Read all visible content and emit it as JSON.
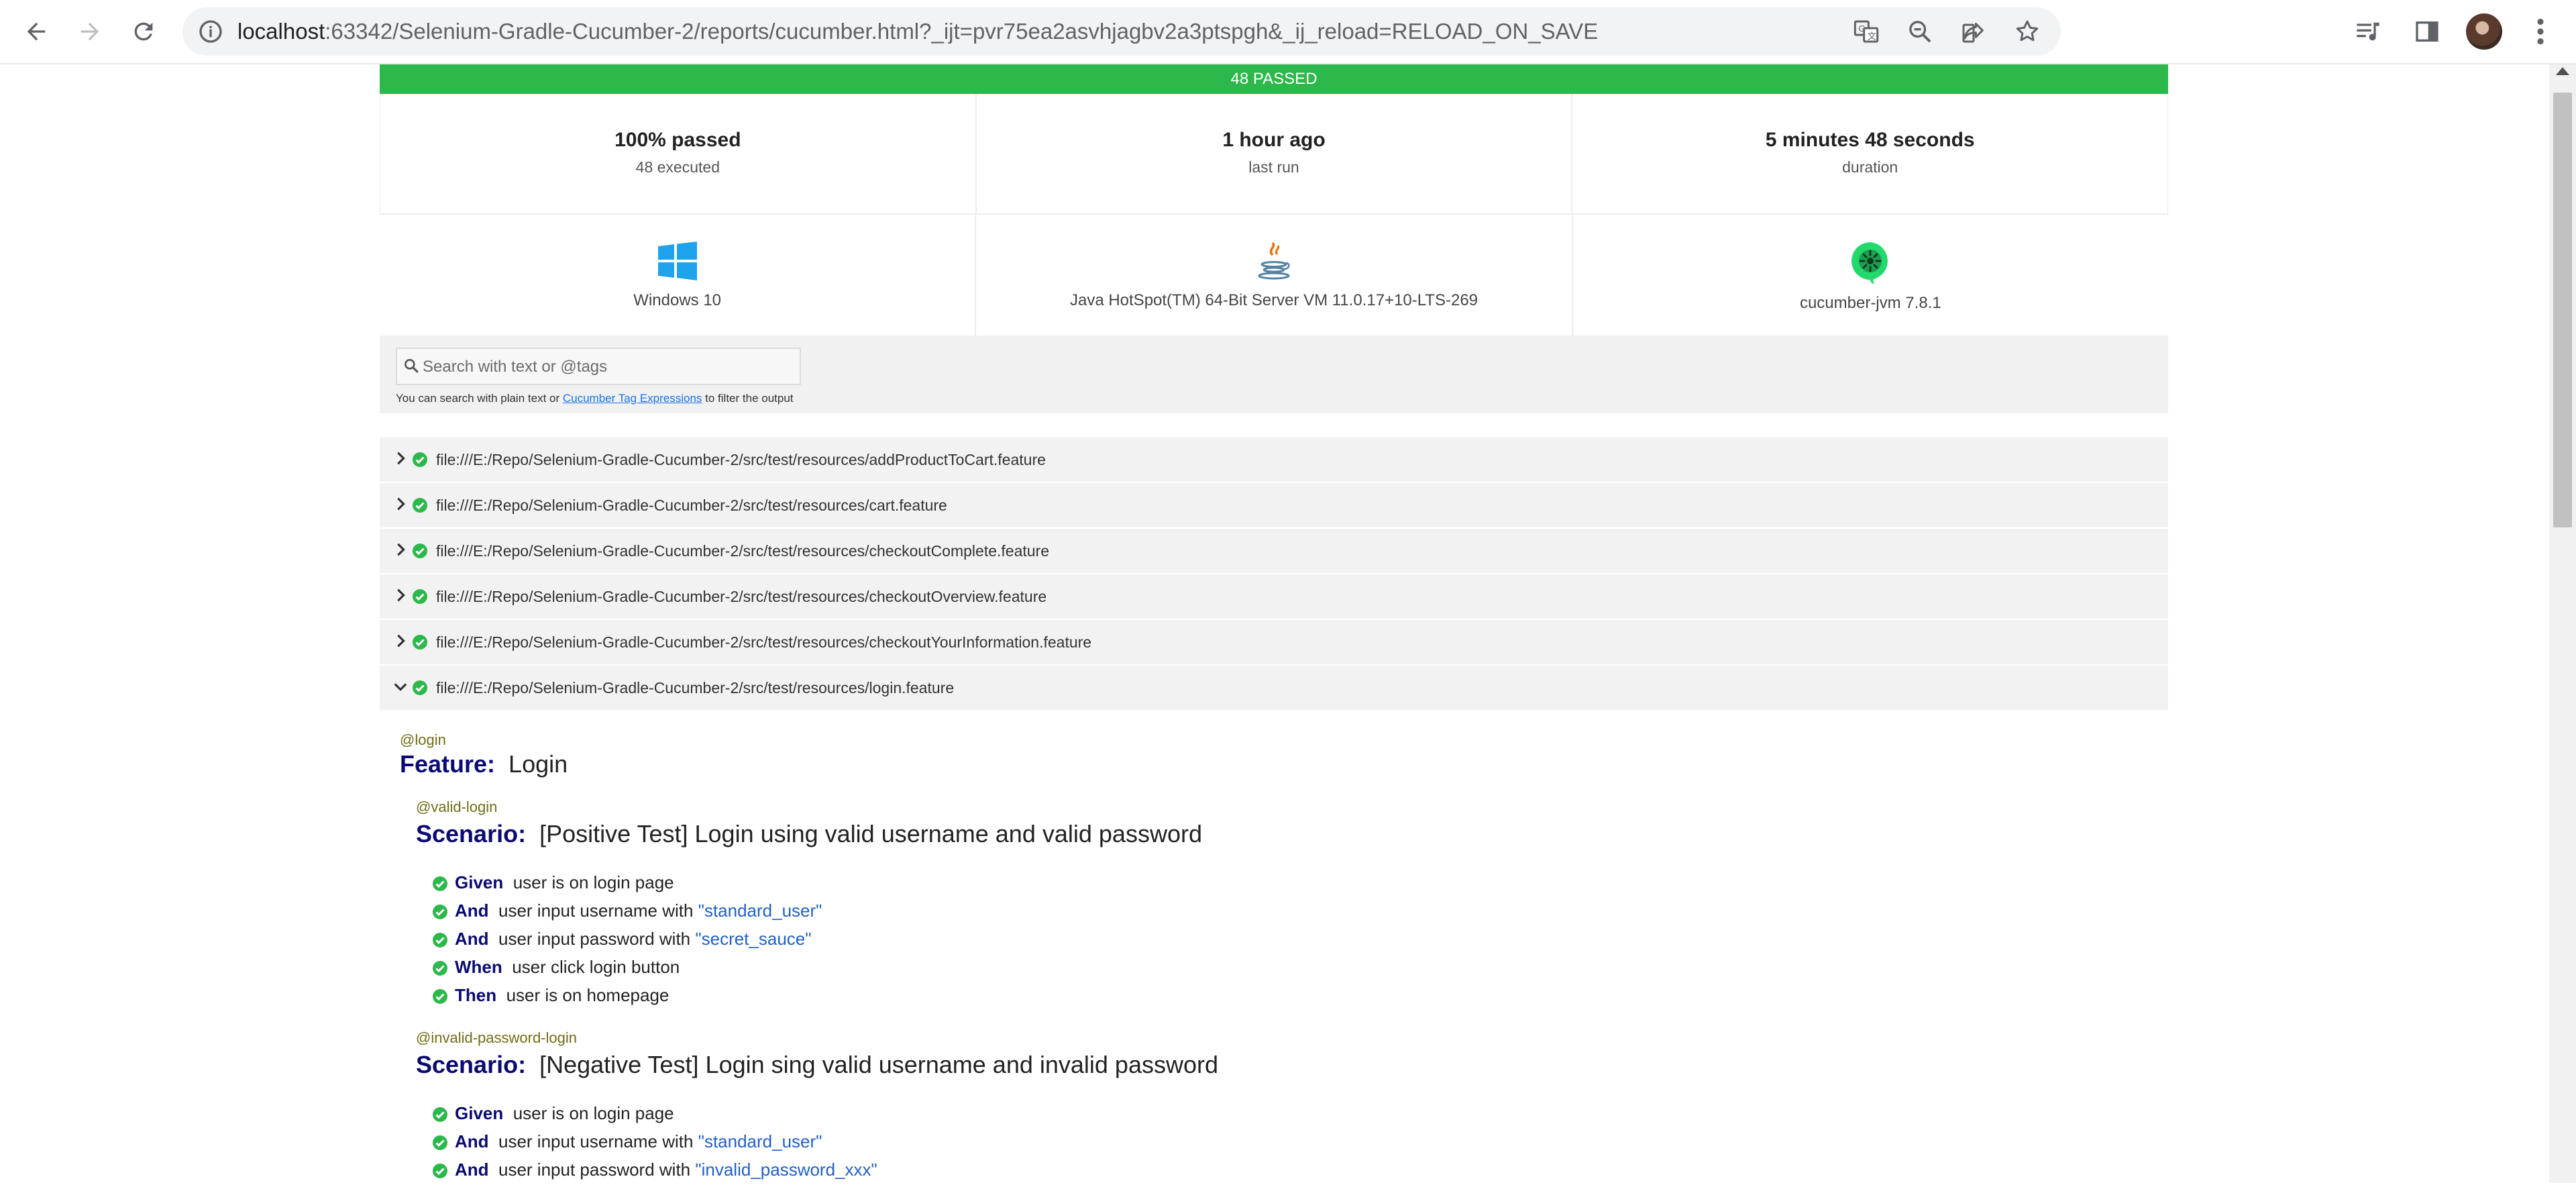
{
  "browser": {
    "url_host": "localhost",
    "url_rest": ":63342/Selenium-Gradle-Cucumber-2/reports/cucumber.html?_ijt=pvr75ea2asvhjagbv2a3ptspgh&_ij_reload=RELOAD_ON_SAVE"
  },
  "report": {
    "banner": "48 PASSED",
    "stats": [
      {
        "value": "100% passed",
        "label": "48 executed"
      },
      {
        "value": "1 hour ago",
        "label": "last run"
      },
      {
        "value": "5 minutes 48 seconds",
        "label": "duration"
      }
    ],
    "env": [
      {
        "label": "Windows 10",
        "icon": "windows-icon"
      },
      {
        "label": "Java HotSpot(TM) 64-Bit Server VM 11.0.17+10-LTS-269",
        "icon": "java-icon"
      },
      {
        "label": "cucumber-jvm 7.8.1",
        "icon": "cucumber-icon"
      }
    ],
    "search": {
      "placeholder": "Search with text or @tags",
      "hint_before": "You can search with plain text or ",
      "hint_link": "Cucumber Tag Expressions",
      "hint_after": " to filter the output"
    },
    "features": [
      {
        "path": "file:///E:/Repo/Selenium-Gradle-Cucumber-2/src/test/resources/addProductToCart.feature",
        "expanded": false
      },
      {
        "path": "file:///E:/Repo/Selenium-Gradle-Cucumber-2/src/test/resources/cart.feature",
        "expanded": false
      },
      {
        "path": "file:///E:/Repo/Selenium-Gradle-Cucumber-2/src/test/resources/checkoutComplete.feature",
        "expanded": false
      },
      {
        "path": "file:///E:/Repo/Selenium-Gradle-Cucumber-2/src/test/resources/checkoutOverview.feature",
        "expanded": false
      },
      {
        "path": "file:///E:/Repo/Selenium-Gradle-Cucumber-2/src/test/resources/checkoutYourInformation.feature",
        "expanded": false
      },
      {
        "path": "file:///E:/Repo/Selenium-Gradle-Cucumber-2/src/test/resources/login.feature",
        "expanded": true
      }
    ],
    "expanded_feature": {
      "tag": "@login",
      "keyword": "Feature:",
      "name": "Login",
      "scenarios": [
        {
          "tag": "@valid-login",
          "keyword": "Scenario:",
          "name": "[Positive Test] Login using valid username and valid password",
          "steps": [
            {
              "kw": "Given",
              "text": "user is on login page",
              "arg": ""
            },
            {
              "kw": "And",
              "text": "user input username with ",
              "arg": "\"standard_user\""
            },
            {
              "kw": "And",
              "text": "user input password with ",
              "arg": "\"secret_sauce\""
            },
            {
              "kw": "When",
              "text": "user click login button",
              "arg": ""
            },
            {
              "kw": "Then",
              "text": "user is on homepage",
              "arg": ""
            }
          ]
        },
        {
          "tag": "@invalid-password-login",
          "keyword": "Scenario:",
          "name": "[Negative Test] Login sing valid username and invalid password",
          "steps": [
            {
              "kw": "Given",
              "text": "user is on login page",
              "arg": ""
            },
            {
              "kw": "And",
              "text": "user input username with ",
              "arg": "\"standard_user\""
            },
            {
              "kw": "And",
              "text": "user input password with ",
              "arg": "\"invalid_password_xxx\""
            }
          ]
        }
      ]
    }
  },
  "colors": {
    "passed": "#2db84b",
    "keyword": "#0a0a72",
    "tag": "#6d6d16",
    "argument": "#2060c8"
  }
}
